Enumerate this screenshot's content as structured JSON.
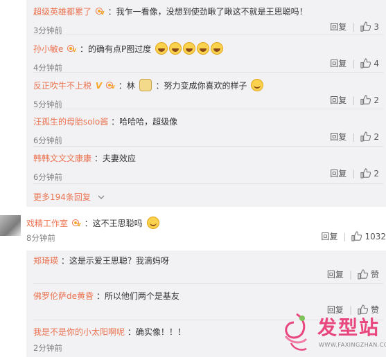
{
  "comments": [
    {
      "user": "超级英雄都累了",
      "text": "：我乍一看像，没想到使劲瞅了瞅这不就是王思聪吗！",
      "time": "3分钟前",
      "reply": "回复",
      "likes": "3"
    },
    {
      "user": "孙小敏e",
      "text": "：的确有点P图过度",
      "time": "4分钟前",
      "reply": "回复",
      "likes": "4"
    },
    {
      "user": "反正吹牛不上税",
      "text_a": "：林",
      "text_b": "：努力变成你喜欢的样子",
      "time": "5分钟前",
      "reply": "回复",
      "likes": "2"
    },
    {
      "user": "汪孤生的母胎solo酱",
      "text": "：哈哈哈，超级像",
      "time": "6分钟前",
      "reply": "回复",
      "likes": "2"
    },
    {
      "user": "韩韩文文文康康",
      "text": "：夫妻效应",
      "time": "6分钟前",
      "reply": "回复",
      "likes": "2"
    }
  ],
  "more_replies": "更多194条回复",
  "main_comment": {
    "user": "戏精工作室",
    "text": "：这不王思聪吗",
    "time": "8分钟前",
    "reply": "回复",
    "likes": "1032"
  },
  "sub_comments": [
    {
      "user": "郑琦瑛",
      "text": "：这是示爱王思聪？我滴妈呀",
      "reply": "回复",
      "likes": "赞"
    },
    {
      "user": "佛罗伦萨de黄昏",
      "text": "：所以他们两个是基友",
      "reply": "回复",
      "likes": "赞"
    },
    {
      "user": "我是不是你的小太阳啊呢",
      "text": "：确实像！！！",
      "time": "2分钟前"
    }
  ],
  "watermark": {
    "brand": "发型站",
    "url": "WWW.FAXINGZHAN.COM"
  },
  "colors": {
    "username": "#eb7350",
    "nested_bg": "#f2f2f5",
    "badge_gold": "#f5a623"
  }
}
